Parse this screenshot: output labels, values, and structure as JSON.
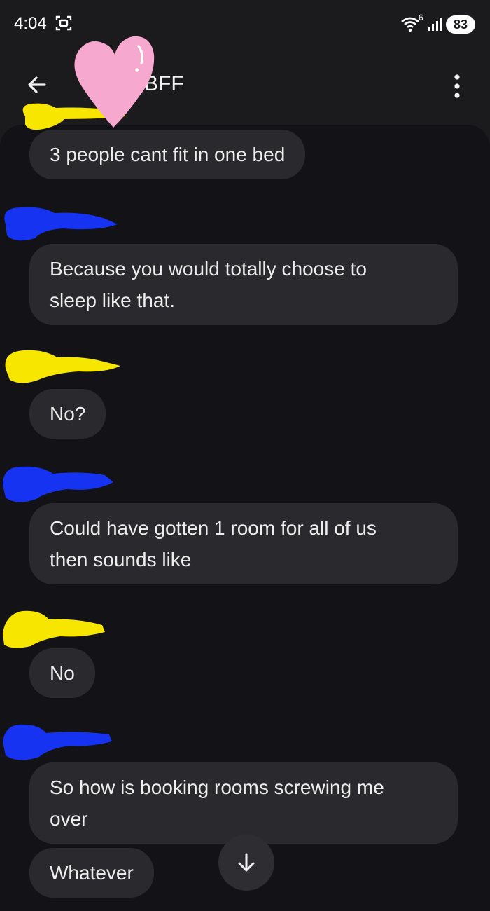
{
  "status_bar": {
    "time": "4:04",
    "wifi_badge": "6",
    "battery": "83",
    "icons": [
      "screen-record-icon",
      "wifi-icon",
      "signal-icon",
      "battery-icon"
    ]
  },
  "app_bar": {
    "title": "BFF",
    "back_icon": "arrow-left-icon",
    "menu_icon": "more-vert-icon"
  },
  "messages": [
    {
      "text": "3 people cant fit in one bed"
    },
    {
      "text": "Because you would totally choose to\nsleep like that."
    },
    {
      "text": "No?"
    },
    {
      "text": "Could have gotten 1 room for all of us\nthen sounds like"
    },
    {
      "text": "No"
    },
    {
      "text": "So how is booking rooms screwing me\nover"
    },
    {
      "text": "Whatever"
    }
  ],
  "scroll_button": {
    "icon": "arrow-down-icon"
  },
  "colors": {
    "background": "#1b1b1d",
    "chat_background": "#131317",
    "bubble": "#2a2a2e",
    "scribble_yellow": "#f7e600",
    "scribble_blue": "#1533f0",
    "heart": "#f6a8cf"
  }
}
